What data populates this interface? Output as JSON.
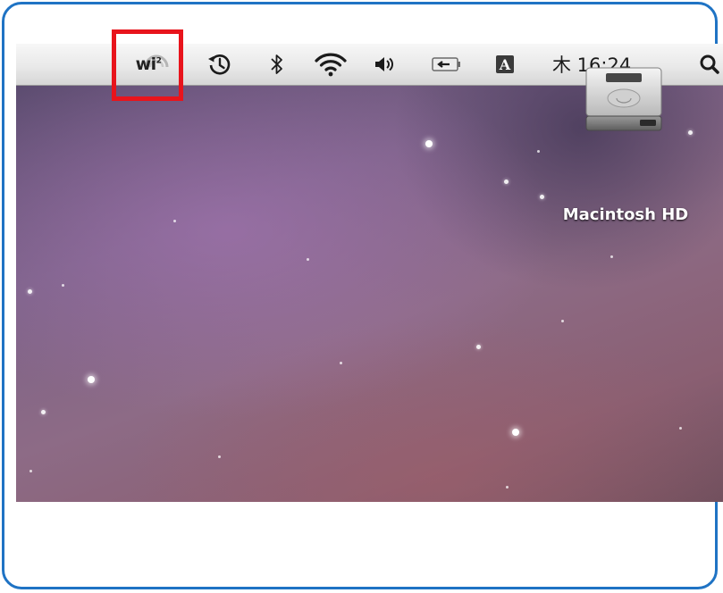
{
  "menubar": {
    "wi2": {
      "label": "wi",
      "superscript": "2",
      "icon": "wi2-icon"
    },
    "time_machine": {
      "icon": "time-machine-icon"
    },
    "bluetooth": {
      "icon": "bluetooth-icon"
    },
    "wifi": {
      "icon": "wifi-icon"
    },
    "volume": {
      "icon": "speaker-icon"
    },
    "battery": {
      "icon": "power-plug-icon"
    },
    "input_menu": {
      "label": "A",
      "icon": "input-menu-icon"
    },
    "clock": "木 16:24",
    "spotlight": {
      "icon": "spotlight-icon"
    }
  },
  "desktop": {
    "drive": {
      "label": "Macintosh HD",
      "icon": "hard-drive-icon"
    }
  },
  "colors": {
    "frame_border": "#1f73c4",
    "highlight": "#e8141c"
  }
}
